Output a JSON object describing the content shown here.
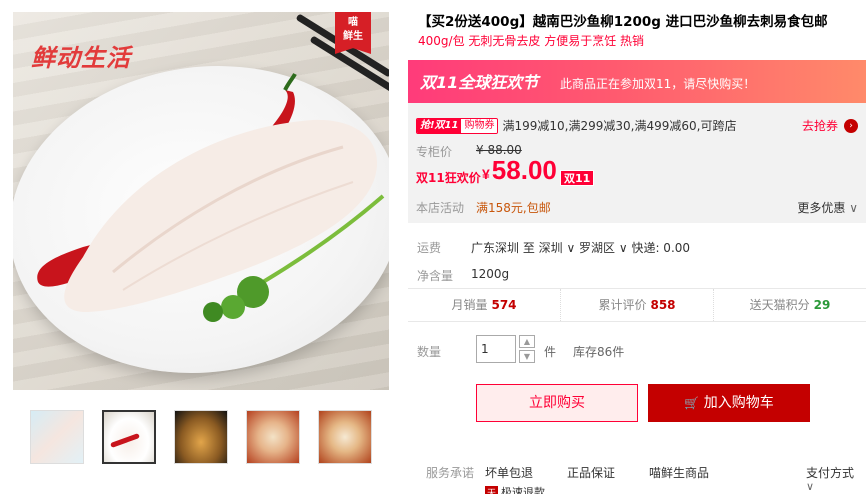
{
  "gallery": {
    "brand_logo": "鲜动生活",
    "corner_tag": "喵\n鲜生",
    "thumbnails": [
      "thumb-1",
      "thumb-2",
      "thumb-3",
      "thumb-4",
      "thumb-5"
    ],
    "active_thumb_index": 1
  },
  "product": {
    "title": "【买2份送400g】越南巴沙鱼柳1200g 进口巴沙鱼柳去刺易食包邮",
    "subtitle": "400g/包 无刺无骨去皮 方便易于烹饪 热销"
  },
  "promo": {
    "logo": "双11全球狂欢节",
    "message": "此商品正在参加双11，请尽快购买！"
  },
  "coupon": {
    "tag_a": "抢!双11",
    "tag_b": "购物券",
    "text": "满199减10,满299减30,满499减60,可跨店",
    "link": "去抢券",
    "link_icon": "›"
  },
  "price": {
    "orig_label": "专柜价",
    "orig_value": "¥ 88.00",
    "sale_label": "双11狂欢价",
    "currency": "¥",
    "sale_value": "58.00",
    "sale_badge": "双11"
  },
  "store_activity": {
    "label": "本店活动",
    "value": "满158元,包邮",
    "more": "更多优惠"
  },
  "shipping": {
    "label": "运费",
    "value": "广东深圳 至 深圳 ∨ 罗湖区 ∨ 快递: 0.00"
  },
  "net_weight": {
    "label": "净含量",
    "value": "1200g"
  },
  "stats": [
    {
      "label": "月销量",
      "value": "574"
    },
    {
      "label": "累计评价",
      "value": "858"
    },
    {
      "label": "送天猫积分",
      "value": "29"
    }
  ],
  "quantity": {
    "label": "数量",
    "value": "1",
    "unit": "件",
    "stock": "库存86件",
    "up": "▲",
    "down": "▼"
  },
  "actions": {
    "buy_now": "立即购买",
    "add_to_cart": "加入购物车",
    "cart_icon": "🛒"
  },
  "service": {
    "label": "服务承诺",
    "items": [
      "坏单包退",
      "正品保证",
      "喵鲜生商品"
    ],
    "sub_tag": "天",
    "sub_text": "极速退款",
    "pay": "支付方式",
    "pay_chevron": "∨"
  },
  "colors": {
    "accent": "#ff0036",
    "dark_red": "#c40000",
    "promo_start": "#ff3b7a",
    "promo_end": "#ff8a6a"
  }
}
